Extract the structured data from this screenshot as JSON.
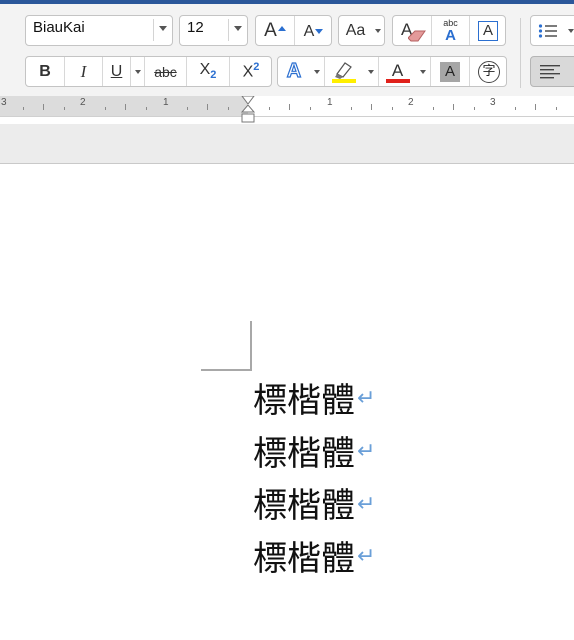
{
  "toolbar": {
    "font_name": {
      "value": "BiauKai"
    },
    "font_size": {
      "value": "12"
    },
    "row1": {
      "grow_font_glyph": "A",
      "shrink_font_glyph": "A",
      "change_case_glyph": "Aa",
      "clear_formatting_glyph": "A",
      "phonetic_top": "abc",
      "phonetic_bottom": "A",
      "char_border_glyph": "A"
    },
    "row2": {
      "bold": "B",
      "italic": "I",
      "underline": "U",
      "strikethrough": "abc",
      "subscript": "X",
      "subscript_small": "2",
      "superscript": "X",
      "superscript_small": "2",
      "text_effects": "A",
      "font_color": "A",
      "char_shading": "A",
      "enclose_char": "字"
    },
    "colors": {
      "highlight": "#ffef00",
      "font_color": "#e0211b",
      "accent": "#2b579a"
    }
  },
  "ruler": {
    "numbers": [
      "3",
      "2",
      "1",
      "1",
      "2",
      "3"
    ]
  },
  "document": {
    "lines": [
      "標楷體",
      "標楷體",
      "標楷體",
      "標楷體"
    ],
    "paragraph_mark": "↵"
  }
}
